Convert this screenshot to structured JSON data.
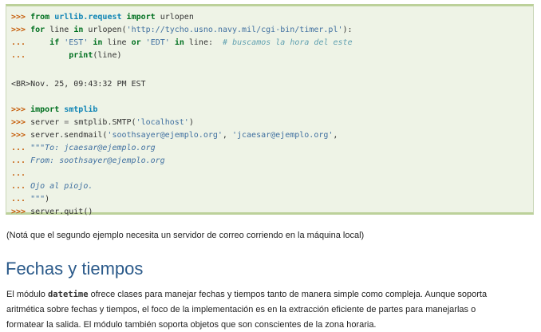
{
  "code": {
    "l1": {
      "p": ">>>",
      "k1": "from",
      "m1": "urllib.request",
      "k2": "import",
      "t": "urlopen"
    },
    "l2": {
      "p": ">>>",
      "k1": "for",
      "t1": "line",
      "k2": "in",
      "t2": "urlopen(",
      "s": "'http://tycho.usno.navy.mil/cgi-bin/timer.pl'",
      "t3": "):"
    },
    "l3": {
      "p": "...",
      "k1": "if",
      "s1": "'EST'",
      "k2": "in",
      "t1": "line",
      "k3": "or",
      "s2": "'EDT'",
      "k4": "in",
      "t2": "line:",
      "c": "# buscamos la hora del este"
    },
    "l4": {
      "p": "...",
      "k": "print",
      "t": "(line)"
    },
    "out": "<BR>Nov. 25, 09:43:32 PM EST",
    "l6": {
      "p": ">>>",
      "k": "import",
      "m": "smtplib"
    },
    "l7": {
      "p": ">>>",
      "t1": "server",
      "o": "=",
      "t2": "smtplib.SMTP(",
      "s": "'localhost'",
      "t3": ")"
    },
    "l8": {
      "p": ">>>",
      "t1": "server.sendmail(",
      "s1": "'soothsayer@ejemplo.org'",
      "t2": ", ",
      "s2": "'jcaesar@ejemplo.org'",
      "t3": ","
    },
    "l9": {
      "p": "...",
      "s": "\"\"\"To: jcaesar@ejemplo.org"
    },
    "l10": {
      "p": "...",
      "s": "From: soothsayer@ejemplo.org"
    },
    "l11": {
      "p": "..."
    },
    "l12": {
      "p": "...",
      "s": "Ojo al piojo."
    },
    "l13": {
      "p": "...",
      "s": "\"\"\"",
      "t": ")"
    },
    "l14": {
      "p": ">>>",
      "t": "server.quit()"
    }
  },
  "note": "(Notá que el segundo ejemplo necesita un servidor de correo corriendo en la máquina local)",
  "heading": "Fechas y tiempos",
  "para": {
    "a1": "El módulo ",
    "mono": "datetime",
    "a2": " ofrece clases para manejar fechas y tiempos tanto de manera simple como compleja. Aunque soporta",
    "b": "aritmética sobre fechas y tiempos, el foco de la implementación es en la extracción eficiente de partes para manejarlas o",
    "c": "formatear la salida. El módulo también soporta objetos que son conscientes de la zona horaria."
  }
}
